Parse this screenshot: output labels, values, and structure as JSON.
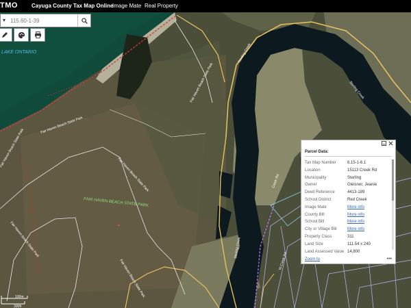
{
  "header": {
    "logo": "TMO",
    "app_title": "Cayuga County Tax Map Online",
    "nav": [
      "Image Mate",
      "Real Property"
    ]
  },
  "search": {
    "value": "115.60-1-39"
  },
  "map": {
    "labels": {
      "lake": "LAKE ONTARIO",
      "park_main": "FAIR HAVEN BEACH STATE PARK",
      "park_road": "Fair Haven Beach State Park",
      "creek": "Sterling Creek",
      "creek_road": "Creek Rd",
      "w_creek_road": "W Creek Rd"
    },
    "scale": [
      "100m",
      "300ft"
    ]
  },
  "parcel_panel": {
    "title": "Parcel Data:",
    "fields": [
      {
        "label": "Tax Map Number",
        "value": "6.15-1-6.1",
        "link": false
      },
      {
        "label": "Location",
        "value": "15113 Creek Rd",
        "link": false
      },
      {
        "label": "Municipality",
        "value": "Sterling",
        "link": false
      },
      {
        "label": "Owner",
        "value": "Gleisner, Jeanie",
        "link": false
      },
      {
        "label": "Deed Reference",
        "value": "4413-189",
        "link": false
      },
      {
        "label": "School District",
        "value": "Red Creek",
        "link": false
      },
      {
        "label": "Image Mate",
        "value": "More info",
        "link": true
      },
      {
        "label": "County Bill",
        "value": "More info",
        "link": true
      },
      {
        "label": "School Bill",
        "value": "More info",
        "link": true
      },
      {
        "label": "City or Village Bill",
        "value": "More info",
        "link": true
      },
      {
        "label": "Property Class",
        "value": "311",
        "link": false
      },
      {
        "label": "Land Size",
        "value": "111.54 x 240",
        "link": false
      },
      {
        "label": "Land Assessed Value",
        "value": "14,800",
        "link": false
      }
    ],
    "zoom_link": "Zoom to",
    "more": "•••"
  },
  "colors": {
    "topbar": "#000000",
    "lake": "#0f4a3a",
    "river": "#0c1a20",
    "road_line": "#e8c060",
    "parcel_line": "#b9b9ff",
    "link": "#3467b5"
  }
}
